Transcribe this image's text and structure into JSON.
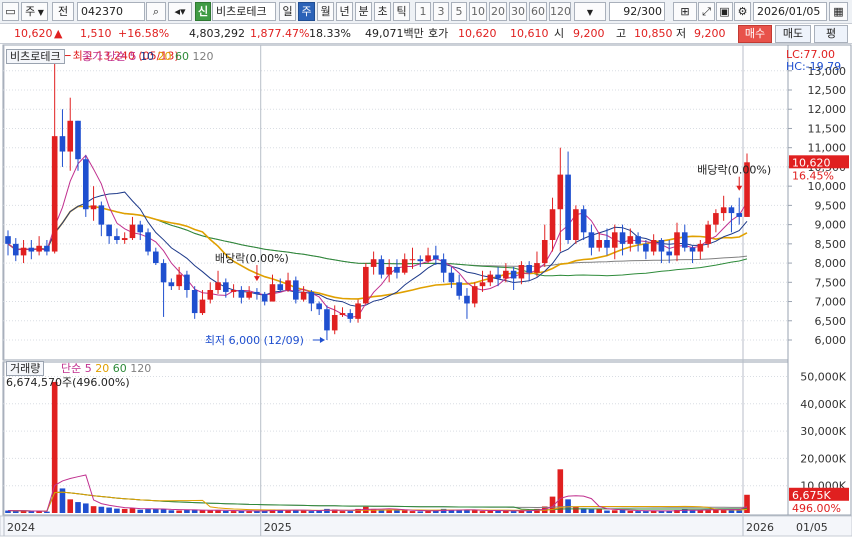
{
  "toolbar": {
    "market": "주",
    "prev_label": "전",
    "code": "042370",
    "credit_badge": "신",
    "stock_name": "비츠로테크",
    "periods": [
      "일",
      "주",
      "월",
      "년",
      "분",
      "초",
      "틱"
    ],
    "active_period": "주",
    "intervals": [
      "1",
      "3",
      "5",
      "10",
      "20",
      "30",
      "60",
      "120"
    ],
    "count": "92",
    "count_total": "/300",
    "date": "2026/01/05"
  },
  "quote": {
    "price": "10,620",
    "change_arrow": "▲",
    "change": "1,510",
    "change_pct": "+16.58%",
    "volume": "4,803,292",
    "volume_pct": "1,877.47%",
    "turnover_pct": "18.33%",
    "amount": "49,071백만",
    "ask_label": "호가",
    "ask": "10,620",
    "bid": "10,610",
    "open_label": "시",
    "open": "9,200",
    "high_label": "고",
    "high": "10,850",
    "low_label": "저",
    "low": "9,200",
    "buy_label": "매수",
    "sell_label": "매도",
    "eval_label": "평"
  },
  "price_panel": {
    "stock_tag": "비츠로테크",
    "legend_close": "종가",
    "legend_ma_label": "단순",
    "ma_periods": [
      "5",
      "10",
      "20",
      "60",
      "120"
    ],
    "lc": "LC:77.00",
    "hc": "HC:-19.79",
    "high_note": "최고 13,240 (05/13)",
    "low_note": "최저 6,000 (12/09)",
    "dividend_note_1": "배당락(0.00%)",
    "dividend_note_2": "배당락(0.00%)",
    "current_price": "10,620",
    "current_pct": "16.45%"
  },
  "volume_panel": {
    "tag": "거래량",
    "legend_ma_label": "단순",
    "ma_periods": [
      "5",
      "20",
      "60",
      "120"
    ],
    "info": "6,674,570주(496.00%)",
    "current_volume": "6,675K",
    "current_pct": "496.00%"
  },
  "x_axis": {
    "labels": [
      "2024",
      "2025",
      "2026"
    ],
    "end_label": "01/05"
  },
  "colors": {
    "up": "#e02020",
    "down": "#1f4fcf",
    "ma5": "#c0308f",
    "ma10": "#1e3a8a",
    "ma20": "#e0a000",
    "ma60": "#2e8b3a",
    "ma120": "#808080",
    "grid": "#d9dde3",
    "panel_title": "#3a3a3a"
  },
  "chart_data": {
    "type": "candlestick",
    "period": "weekly",
    "y_axis_price": {
      "min": 6000,
      "max": 13000,
      "ticks": [
        6000,
        6500,
        7000,
        7500,
        8000,
        8500,
        9000,
        9500,
        10000,
        10500,
        11000,
        11500,
        12000,
        12500,
        13000
      ]
    },
    "y_axis_volume": {
      "ticks_label": [
        "10,000K",
        "20,000K",
        "30,000K",
        "40,000K",
        "50,000K"
      ],
      "ticks": [
        10000,
        20000,
        30000,
        40000,
        50000
      ]
    },
    "candles": [
      [
        8700,
        8500,
        8850,
        8200,
        900
      ],
      [
        8500,
        8200,
        8650,
        8050,
        700
      ],
      [
        8200,
        8400,
        8600,
        8000,
        800
      ],
      [
        8400,
        8300,
        8600,
        8100,
        600
      ],
      [
        8300,
        8450,
        8700,
        8200,
        700
      ],
      [
        8450,
        8300,
        8600,
        8200,
        500
      ],
      [
        8300,
        11300,
        13240,
        8250,
        48000
      ],
      [
        11300,
        10900,
        12000,
        10500,
        9000
      ],
      [
        10900,
        11700,
        12300,
        10400,
        5000
      ],
      [
        11700,
        10700,
        11700,
        10400,
        4000
      ],
      [
        10700,
        9400,
        10800,
        9200,
        3500
      ],
      [
        9400,
        9500,
        10000,
        9100,
        2500
      ],
      [
        9500,
        9000,
        9600,
        8700,
        2300
      ],
      [
        9000,
        8700,
        9000,
        8500,
        2000
      ],
      [
        8700,
        8600,
        8900,
        8500,
        1600
      ],
      [
        8600,
        8650,
        8800,
        8500,
        1500
      ],
      [
        8650,
        9000,
        9200,
        8600,
        1800
      ],
      [
        9000,
        8800,
        9100,
        8600,
        1200
      ],
      [
        8800,
        8300,
        8900,
        8200,
        1500
      ],
      [
        8300,
        8000,
        8400,
        7950,
        1500
      ],
      [
        8000,
        7500,
        8100,
        6600,
        1400
      ],
      [
        7500,
        7400,
        7600,
        7300,
        1000
      ],
      [
        7400,
        7700,
        7900,
        7300,
        900
      ],
      [
        7700,
        7300,
        7800,
        7100,
        1100
      ],
      [
        7300,
        6700,
        7400,
        6550,
        1300
      ],
      [
        6700,
        7050,
        7300,
        6650,
        1000
      ],
      [
        7050,
        7300,
        7500,
        6950,
        900
      ],
      [
        7300,
        7500,
        7800,
        7200,
        1100
      ],
      [
        7500,
        7250,
        7600,
        7100,
        800
      ],
      [
        7250,
        7300,
        7450,
        7100,
        700
      ],
      [
        7300,
        7100,
        7400,
        6950,
        800
      ],
      [
        7100,
        7250,
        7400,
        7050,
        700
      ],
      [
        7250,
        7200,
        7350,
        7050,
        900
      ],
      [
        7200,
        7000,
        7250,
        6900,
        800
      ],
      [
        7000,
        7450,
        7700,
        7000,
        1300
      ],
      [
        7450,
        7300,
        7600,
        7250,
        1100
      ],
      [
        7300,
        7550,
        7750,
        7250,
        1100
      ],
      [
        7550,
        7050,
        7650,
        6950,
        1000
      ],
      [
        7050,
        7250,
        7400,
        7000,
        900
      ],
      [
        7250,
        6950,
        7300,
        6750,
        700
      ],
      [
        6950,
        6800,
        7000,
        6650,
        900
      ],
      [
        6800,
        6250,
        6900,
        6000,
        1500
      ],
      [
        6250,
        6650,
        6900,
        6150,
        1300
      ],
      [
        6650,
        6700,
        6850,
        6600,
        700
      ],
      [
        6700,
        6550,
        6800,
        6450,
        700
      ],
      [
        6550,
        6950,
        7050,
        6450,
        1500
      ],
      [
        6950,
        7900,
        8000,
        6950,
        2300
      ],
      [
        7900,
        8100,
        8300,
        7700,
        1500
      ],
      [
        8100,
        7700,
        8200,
        7600,
        1100
      ],
      [
        7700,
        7900,
        8100,
        7500,
        1300
      ],
      [
        7900,
        7750,
        8100,
        7600,
        1000
      ],
      [
        7750,
        8100,
        8250,
        7700,
        900
      ],
      [
        8100,
        8100,
        8400,
        7850,
        700
      ],
      [
        8100,
        8050,
        8200,
        7900,
        600
      ],
      [
        8050,
        8200,
        8400,
        8000,
        800
      ],
      [
        8200,
        8100,
        8450,
        7950,
        1000
      ],
      [
        8100,
        7750,
        8250,
        7500,
        1500
      ],
      [
        7750,
        7500,
        7900,
        7350,
        1200
      ],
      [
        7500,
        7150,
        7700,
        7050,
        900
      ],
      [
        7150,
        6950,
        7350,
        6550,
        1000
      ],
      [
        6950,
        7400,
        7500,
        6850,
        1000
      ],
      [
        7400,
        7500,
        7800,
        7250,
        700
      ],
      [
        7500,
        7700,
        7800,
        7400,
        1000
      ],
      [
        7700,
        7600,
        7900,
        7400,
        800
      ],
      [
        7600,
        7800,
        8000,
        7500,
        800
      ],
      [
        7800,
        7600,
        7900,
        7300,
        700
      ],
      [
        7600,
        7950,
        8050,
        7450,
        1000
      ],
      [
        7950,
        7750,
        8050,
        7550,
        900
      ],
      [
        7750,
        8000,
        8300,
        7650,
        1500
      ],
      [
        8000,
        8600,
        9000,
        7900,
        2400
      ],
      [
        8600,
        9400,
        9700,
        8300,
        6000
      ],
      [
        9400,
        10300,
        11000,
        8300,
        16000
      ],
      [
        10300,
        8600,
        10900,
        8500,
        5000
      ],
      [
        8600,
        9400,
        9500,
        8500,
        2300
      ],
      [
        9400,
        8800,
        9500,
        8600,
        1700
      ],
      [
        8800,
        8400,
        9000,
        8200,
        1400
      ],
      [
        8400,
        8600,
        8800,
        8300,
        1600
      ],
      [
        8600,
        8400,
        8900,
        8200,
        900
      ],
      [
        8400,
        8800,
        9000,
        8100,
        1000
      ],
      [
        8800,
        8500,
        9000,
        8200,
        1100
      ],
      [
        8500,
        8700,
        8900,
        8300,
        800
      ],
      [
        8700,
        8500,
        8800,
        8300,
        700
      ],
      [
        8500,
        8300,
        8600,
        8100,
        700
      ],
      [
        8300,
        8600,
        8750,
        8200,
        800
      ],
      [
        8600,
        8300,
        8650,
        8000,
        900
      ],
      [
        8300,
        8200,
        8600,
        8000,
        800
      ],
      [
        8200,
        8800,
        9050,
        8050,
        1100
      ],
      [
        8800,
        8400,
        9000,
        8300,
        1300
      ],
      [
        8400,
        8300,
        8450,
        8000,
        1000
      ],
      [
        8300,
        8500,
        8600,
        8100,
        1000
      ],
      [
        8500,
        9000,
        9100,
        8400,
        1200
      ],
      [
        9000,
        9300,
        9400,
        8800,
        1600
      ],
      [
        9300,
        9450,
        9750,
        9100,
        1300
      ],
      [
        9450,
        9300,
        9500,
        8800,
        1200
      ],
      [
        9300,
        9200,
        9700,
        9000,
        1000
      ],
      [
        9200,
        10620,
        10850,
        9200,
        6675
      ]
    ]
  }
}
